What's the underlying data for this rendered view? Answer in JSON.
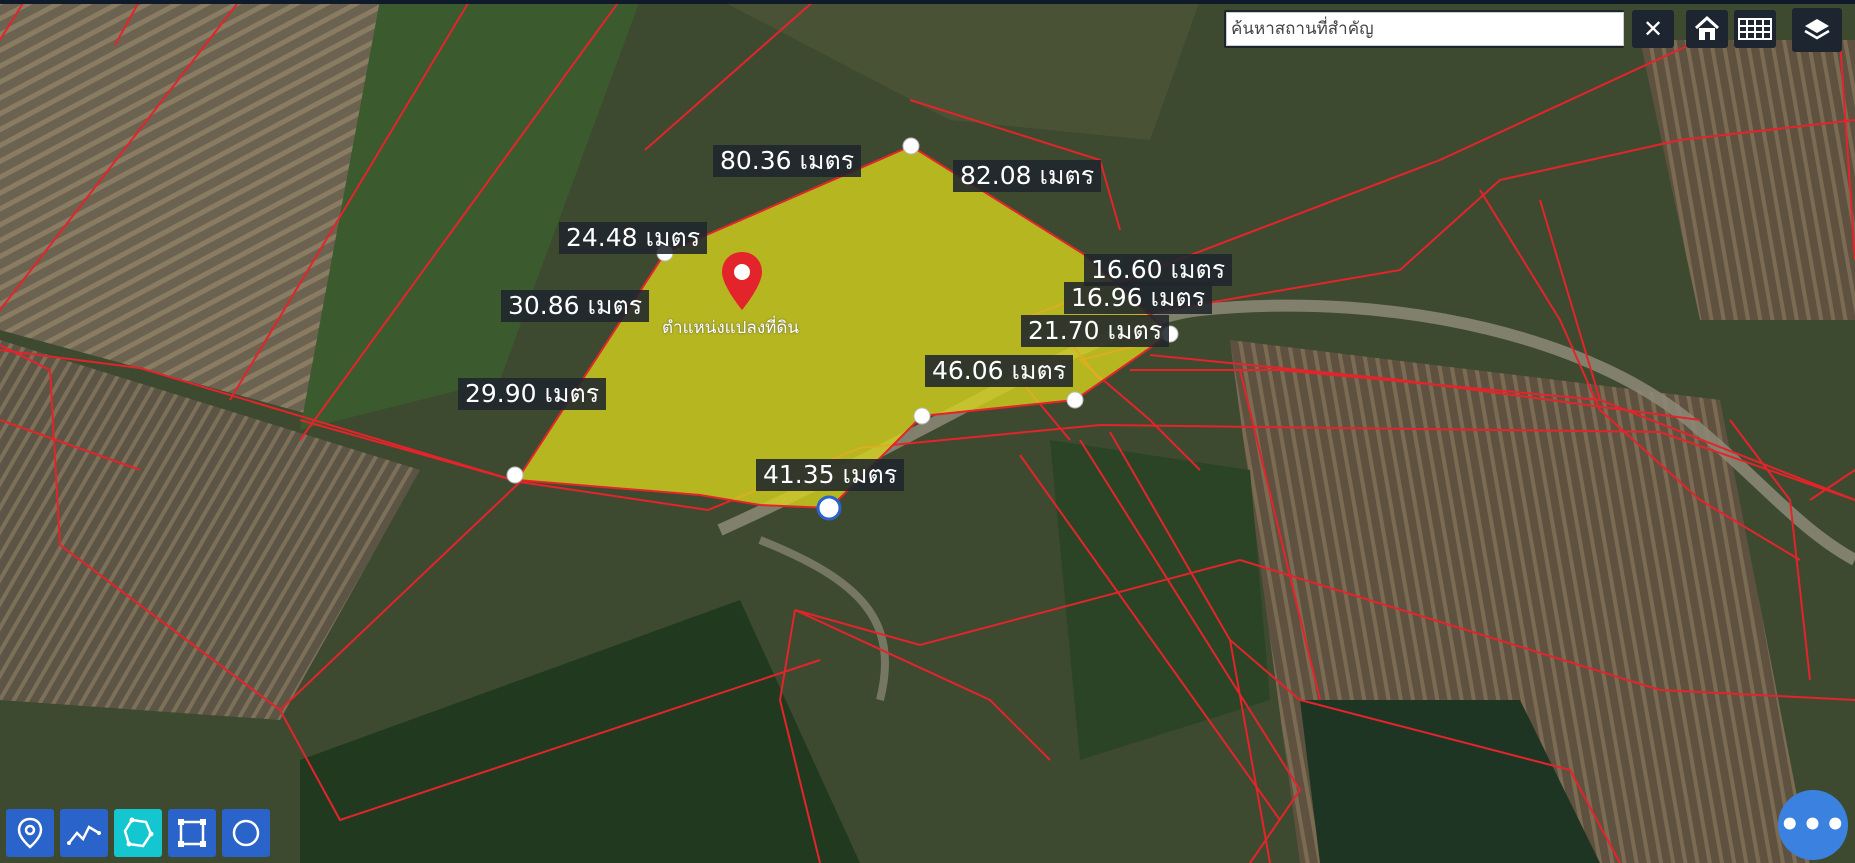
{
  "search": {
    "placeholder": "ค้นหาสถานที่สำคัญ",
    "clear_label": "✕"
  },
  "controls": {
    "home_icon": "home-icon",
    "grid_icon": "grid-icon",
    "layers_icon": "layers-icon"
  },
  "measurements": {
    "m1": "80.36 เมตร",
    "m2": "82.08 เมตร",
    "m3": "24.48 เมตร",
    "m4": "30.86 เมตร",
    "m5": "16.60 เมตร",
    "m6": "16.96 เมตร",
    "m7": "21.70 เมตร",
    "m8": "46.06 เมตร",
    "m9": "29.90 เมตร",
    "m10": "41.35 เมตร"
  },
  "pin": {
    "label": "ตำแหน่งแปลงที่ดิน"
  },
  "toolbar": {
    "tools": [
      "marker-tool",
      "polyline-tool",
      "polygon-tool",
      "rectangle-tool",
      "circle-tool"
    ],
    "active": "polygon-tool"
  },
  "fab": {
    "label": "•••"
  },
  "colors": {
    "parcel_line": "#e3242b",
    "polygon_fill": "#d9d51c",
    "tool_bg": "#2a63c9",
    "tool_active": "#13c6cf",
    "fab": "#3b82e0"
  }
}
